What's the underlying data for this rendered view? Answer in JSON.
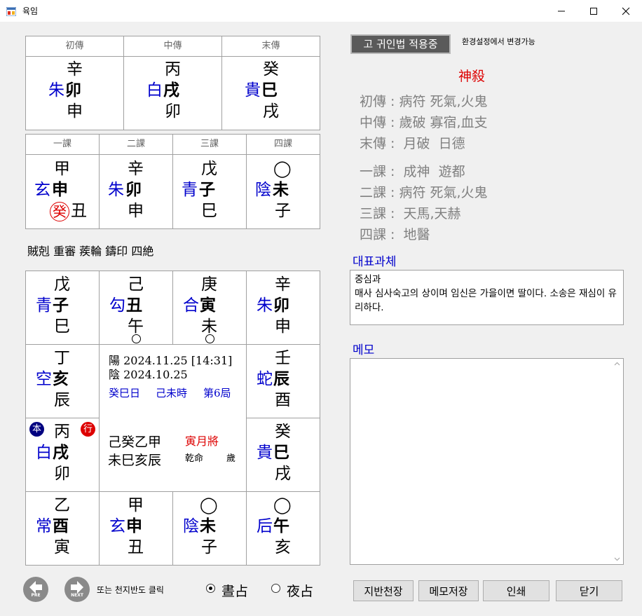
{
  "window": {
    "title": "육임",
    "minimize": "—",
    "maximize": "☐",
    "close": "✕"
  },
  "sanjeon": {
    "headers": [
      "初傳",
      "中傳",
      "末傳"
    ],
    "cols": [
      {
        "top": "辛",
        "general": "朱",
        "branch": "卯",
        "bottom": "申"
      },
      {
        "top": "丙",
        "general": "白",
        "branch": "戌",
        "bottom": "卯"
      },
      {
        "top": "癸",
        "general": "貴",
        "branch": "巳",
        "bottom": "戌"
      }
    ]
  },
  "sagwa": {
    "headers": [
      "一課",
      "二課",
      "三課",
      "四課"
    ],
    "cols": [
      {
        "top": "甲",
        "general": "玄",
        "branch": "申",
        "bottom": "丑",
        "badge": "癸"
      },
      {
        "top": "辛",
        "general": "朱",
        "branch": "卯",
        "bottom": "申"
      },
      {
        "top": "戊",
        "general": "青",
        "branch": "子",
        "bottom": "巳"
      },
      {
        "top": "◯",
        "general": "陰",
        "branch": "未",
        "bottom": "子"
      }
    ]
  },
  "classification": "賊剋 重審 蒺輪 鑄印 四絶",
  "board": {
    "top": [
      {
        "top": "戊",
        "general": "青",
        "branch": "子",
        "bottom": "巳"
      },
      {
        "top": "己",
        "general": "勾",
        "branch": "丑",
        "bottom": "午"
      },
      {
        "top": "庚",
        "general": "合",
        "branch": "寅",
        "bottom": "未"
      },
      {
        "top": "辛",
        "general": "朱",
        "branch": "卯",
        "bottom": "申"
      }
    ],
    "left": [
      {
        "top": "丁",
        "general": "空",
        "branch": "亥",
        "bottom": "辰"
      },
      {
        "top": "丙",
        "general": "白",
        "branch": "戌",
        "bottom": "卯",
        "badge_left": "本",
        "badge_right": "行"
      }
    ],
    "right": [
      {
        "top": "壬",
        "general": "蛇",
        "branch": "辰",
        "bottom": "酉"
      },
      {
        "top": "癸",
        "general": "貴",
        "branch": "巳",
        "bottom": "戌"
      }
    ],
    "bottom": [
      {
        "top": "乙",
        "general": "常",
        "branch": "酉",
        "bottom": "寅"
      },
      {
        "top": "甲",
        "general": "玄",
        "branch": "申",
        "bottom": "丑"
      },
      {
        "top": "◯",
        "general": "陰",
        "branch": "未",
        "bottom": "子"
      },
      {
        "top": "◯",
        "general": "后",
        "branch": "午",
        "bottom": "亥"
      }
    ],
    "center": {
      "solar": "陽 2024.11.25 [14:31]",
      "lunar": "陰 2024.10.25",
      "day": "癸巳日",
      "hour": "己未時",
      "ju": "第6局",
      "stems": "己癸乙甲",
      "branches": "未巳亥辰",
      "general_month": "寅月將",
      "destiny": "乾命",
      "age": "歲"
    }
  },
  "nav": {
    "prev": "PRE",
    "next": "NEXT",
    "hint": "또는 천지반도 클릭",
    "day": "晝占",
    "night": "夜占"
  },
  "right": {
    "guiin_button": "고 귀인법 적용중",
    "settings_hint": "환경설정에서 변경가능",
    "sinsal_title": "神殺",
    "sinsal": [
      "初傳 : 病符 死氣,火鬼",
      "中傳 : 歲破 寡宿,血支",
      "末傳 :  月破  日德",
      "一課 :  成神  遊都",
      "二課 : 病符 死氣,火鬼",
      "三課 :  天馬,天赫",
      "四課 :  地醫"
    ],
    "rep_title": "대표과체",
    "rep_name": "중심과",
    "rep_text": "매사 심사숙고의 상이며 임신은 가을이면 딸이다. 소송은 재심이 유리하다.",
    "memo_title": "메모",
    "memo_value": ""
  },
  "buttons": {
    "board": "지반천장",
    "save_memo": "메모저장",
    "print": "인쇄",
    "close": "닫기"
  },
  "colors": {
    "blue": "#0000cc",
    "red": "#dd0000",
    "gray": "#808080"
  }
}
